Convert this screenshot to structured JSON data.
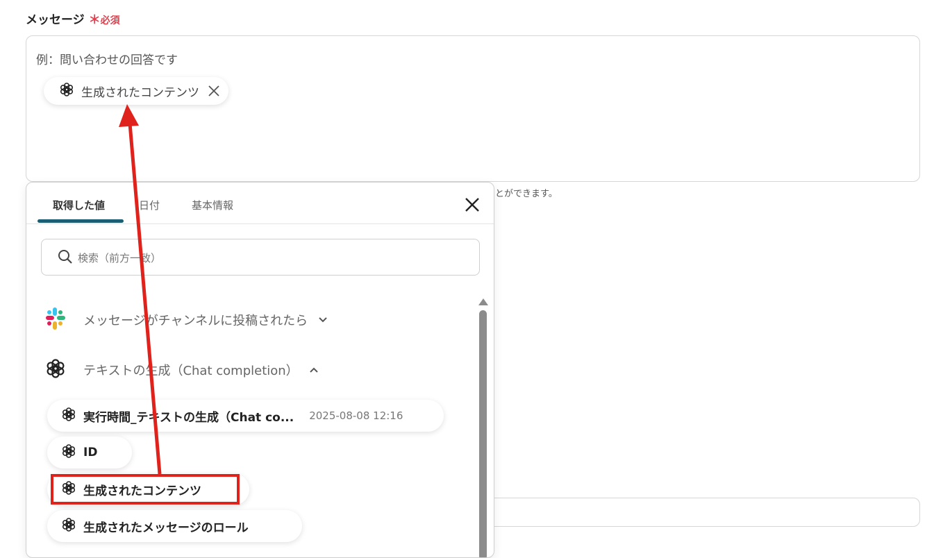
{
  "form": {
    "message_label": "メッセージ",
    "required_mark": "＊",
    "required_text": "必須",
    "placeholder": "例：問い合わせの回答です",
    "inserted_chip": "生成されたコンテンツ",
    "hint_text": "とができます。"
  },
  "popup": {
    "tabs": [
      {
        "label": "取得した値",
        "active": true
      },
      {
        "label": "日付",
        "active": false
      },
      {
        "label": "基本情報",
        "active": false
      }
    ],
    "search_placeholder": "検索（前方一致）",
    "groups": [
      {
        "label": "メッセージがチャンネルに投稿されたら",
        "icon": "slack-icon",
        "expanded": false
      },
      {
        "label": "テキストの生成（Chat completion）",
        "icon": "openai-icon",
        "expanded": true
      }
    ],
    "items": [
      {
        "label": "実行時間_テキストの生成（Chat co...",
        "date": "2025-08-08 12:16"
      },
      {
        "label": "ID",
        "date": ""
      },
      {
        "label": "生成されたコンテンツ",
        "date": ""
      },
      {
        "label": "生成されたメッセージのロール",
        "date": ""
      }
    ]
  },
  "annotation": {
    "highlight_color": "#e0221c",
    "highlighted_item": "生成されたコンテンツ"
  },
  "colors": {
    "required": "#e0404e",
    "tab_indicator": "#1b5f74"
  }
}
